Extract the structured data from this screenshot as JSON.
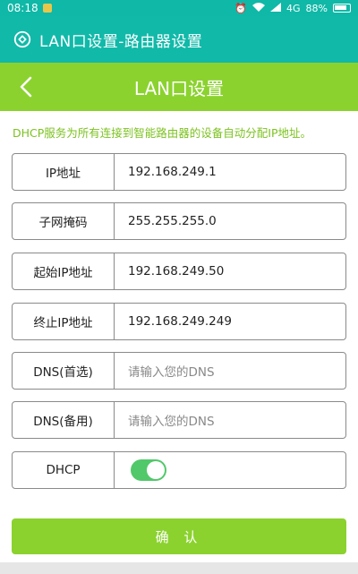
{
  "status_bar": {
    "time": "08:18",
    "network": "4G",
    "battery": "88%"
  },
  "app_bar": {
    "title": "LAN口设置-路由器设置"
  },
  "header": {
    "title": "LAN口设置"
  },
  "notice": "DHCP服务为所有连接到智能路由器的设备自动分配IP地址。",
  "fields": [
    {
      "label": "IP地址",
      "value": "192.168.249.1"
    },
    {
      "label": "子网掩码",
      "value": "255.255.255.0"
    },
    {
      "label": "起始IP地址",
      "value": "192.168.249.50"
    },
    {
      "label": "终止IP地址",
      "value": "192.168.249.249"
    },
    {
      "label": "DNS(首选)",
      "placeholder": "请输入您的DNS"
    },
    {
      "label": "DNS(备用)",
      "placeholder": "请输入您的DNS"
    }
  ],
  "dhcp": {
    "label": "DHCP",
    "enabled": true,
    "color": "#51c86a"
  },
  "confirm_label": "确 认",
  "colors": {
    "app_bar": "#11b9a9",
    "header": "#8bd22e",
    "accent_text": "#7cc21f"
  }
}
